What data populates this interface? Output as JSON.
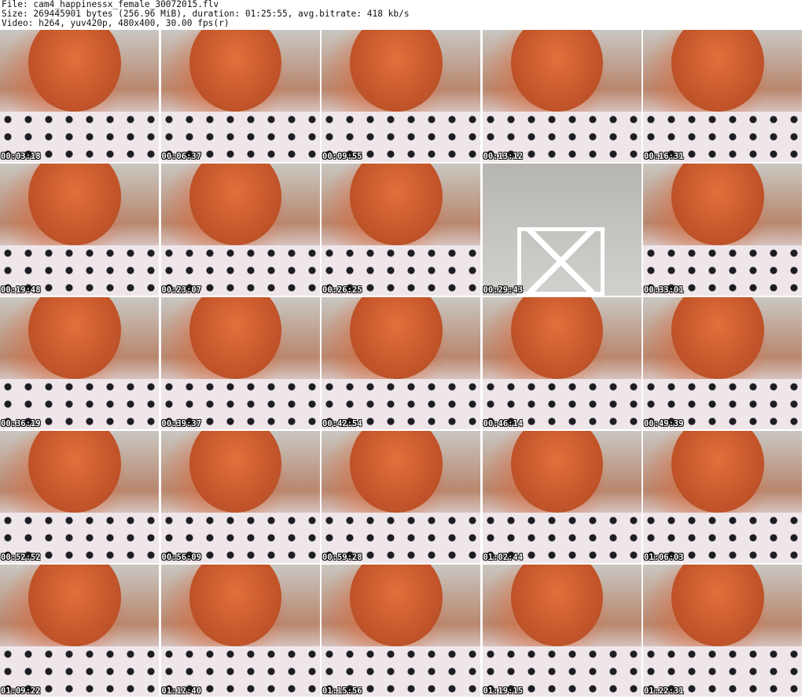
{
  "header": {
    "line1": "File: cam4_happinessx_female_30072015.flv",
    "line2": "Size: 269445901 bytes (256.96 MiB), duration: 01:25:55, avg.bitrate: 418 kb/s",
    "line3": "Video: h264, yuv420p, 480x400, 30.00 fps(r)"
  },
  "thumbnails": [
    {
      "timestamp": "00:03:18"
    },
    {
      "timestamp": "00:06:37"
    },
    {
      "timestamp": "00:09:55"
    },
    {
      "timestamp": "00:13:12"
    },
    {
      "timestamp": "00:16:31"
    },
    {
      "timestamp": "00:19:48"
    },
    {
      "timestamp": "00:23:07"
    },
    {
      "timestamp": "00:26:25"
    },
    {
      "timestamp": "00:29:43",
      "scene": "empty-chair"
    },
    {
      "timestamp": "00:33:01"
    },
    {
      "timestamp": "00:36:19"
    },
    {
      "timestamp": "00:39:37"
    },
    {
      "timestamp": "00:42:54"
    },
    {
      "timestamp": "00:46:14"
    },
    {
      "timestamp": "00:49:39"
    },
    {
      "timestamp": "00:52:52"
    },
    {
      "timestamp": "00:56:09"
    },
    {
      "timestamp": "00:59:28"
    },
    {
      "timestamp": "01:02:44"
    },
    {
      "timestamp": "01:06:03"
    },
    {
      "timestamp": "01:09:22"
    },
    {
      "timestamp": "01:12:40"
    },
    {
      "timestamp": "01:15:56"
    },
    {
      "timestamp": "01:19:15"
    },
    {
      "timestamp": "01:22:31"
    }
  ]
}
